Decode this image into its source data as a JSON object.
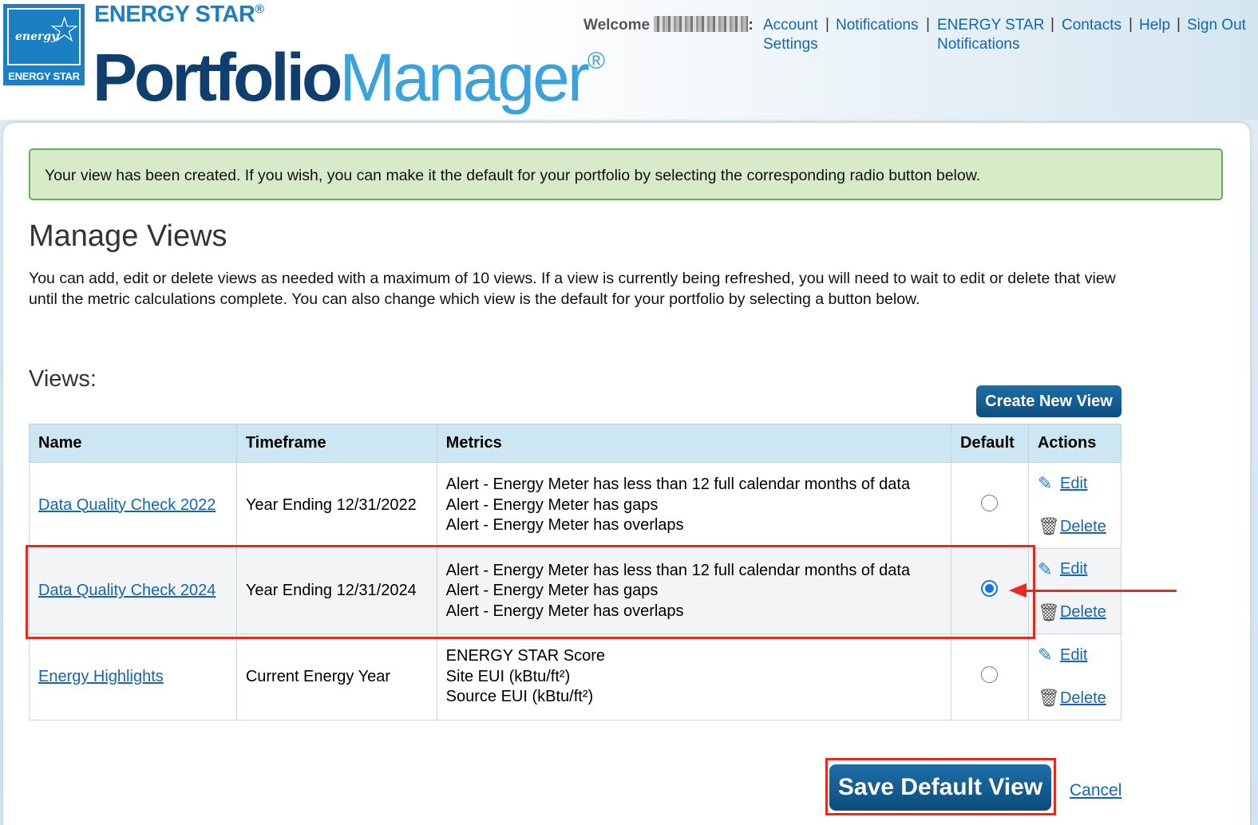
{
  "brand": {
    "logo_script": "energy",
    "logo_label": "ENERGY STAR",
    "top": "ENERGY STAR",
    "top_reg": "®",
    "main_part1": "Portfolio",
    "main_part2": "Manager",
    "main_reg": "®"
  },
  "topnav": {
    "welcome": "Welcome",
    "welcome_suffix": ":",
    "account_settings_line1": "Account",
    "account_settings_line2": "Settings",
    "notifications": "Notifications",
    "es_notifications_line1": "ENERGY STAR",
    "es_notifications_line2": "Notifications",
    "contacts": "Contacts",
    "help": "Help",
    "sign_out": "Sign Out",
    "separator": "|"
  },
  "alert": {
    "message": "Your view has been created. If you wish, you can make it the default for your portfolio by selecting the corresponding radio button below."
  },
  "page": {
    "title": "Manage Views",
    "intro_line1": "You can add, edit or delete views as needed with a maximum of 10 views. If a view is currently being refreshed, you will need to wait to edit or delete that view",
    "intro_line2": "until the metric calculations complete. You can also change which view is the default for your portfolio by selecting a button below.",
    "views_heading": "Views:",
    "create_button": "Create New View"
  },
  "table": {
    "headers": {
      "name": "Name",
      "timeframe": "Timeframe",
      "metrics": "Metrics",
      "default": "Default",
      "actions": "Actions"
    },
    "rows": [
      {
        "name": "Data Quality Check 2022",
        "timeframe": "Year Ending 12/31/2022",
        "metrics": [
          "Alert - Energy Meter has less than 12 full calendar months of data",
          "Alert - Energy Meter has gaps",
          "Alert - Energy Meter has overlaps"
        ],
        "default": false
      },
      {
        "name": "Data Quality Check 2024",
        "timeframe": "Year Ending 12/31/2024",
        "metrics": [
          "Alert - Energy Meter has less than 12 full calendar months of data",
          "Alert - Energy Meter has gaps",
          "Alert - Energy Meter has overlaps"
        ],
        "default": true
      },
      {
        "name": "Energy Highlights",
        "timeframe": "Current Energy Year",
        "metrics": [
          "ENERGY STAR Score",
          "Site EUI (kBtu/ft²)",
          "Source EUI (kBtu/ft²)"
        ],
        "default": false
      }
    ],
    "edit_label": "Edit",
    "delete_label": "Delete"
  },
  "footer": {
    "save_button": "Save Default View",
    "cancel": "Cancel"
  },
  "icons": {
    "edit": "pencil-icon",
    "delete": "trash-icon"
  },
  "colors": {
    "link": "#1565b5",
    "button": "#0e4f80",
    "alert_bg": "#d7ebc8",
    "alert_border": "#64b05c",
    "table_header": "#cde7f2",
    "annotation": "#e8291c"
  }
}
